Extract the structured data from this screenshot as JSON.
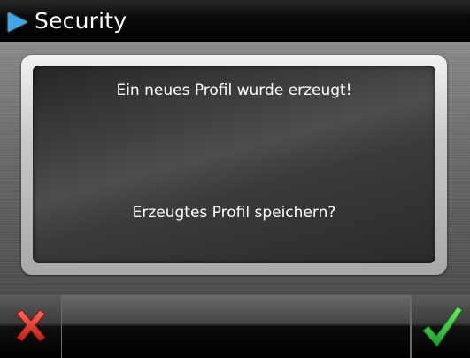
{
  "window": {
    "title": "Security",
    "title_icon": "play-arrow-icon",
    "accent_color": "#3fa6e8"
  },
  "dialog": {
    "message_line_1": "Ein neues Profil wurde erzeugt!",
    "message_line_2": "Erzeugtes Profil speichern?"
  },
  "buttons": {
    "cancel_icon": "red-x-icon",
    "cancel_color": "#d8322a",
    "confirm_icon": "green-checkmark-icon",
    "confirm_color": "#2fb83a"
  }
}
